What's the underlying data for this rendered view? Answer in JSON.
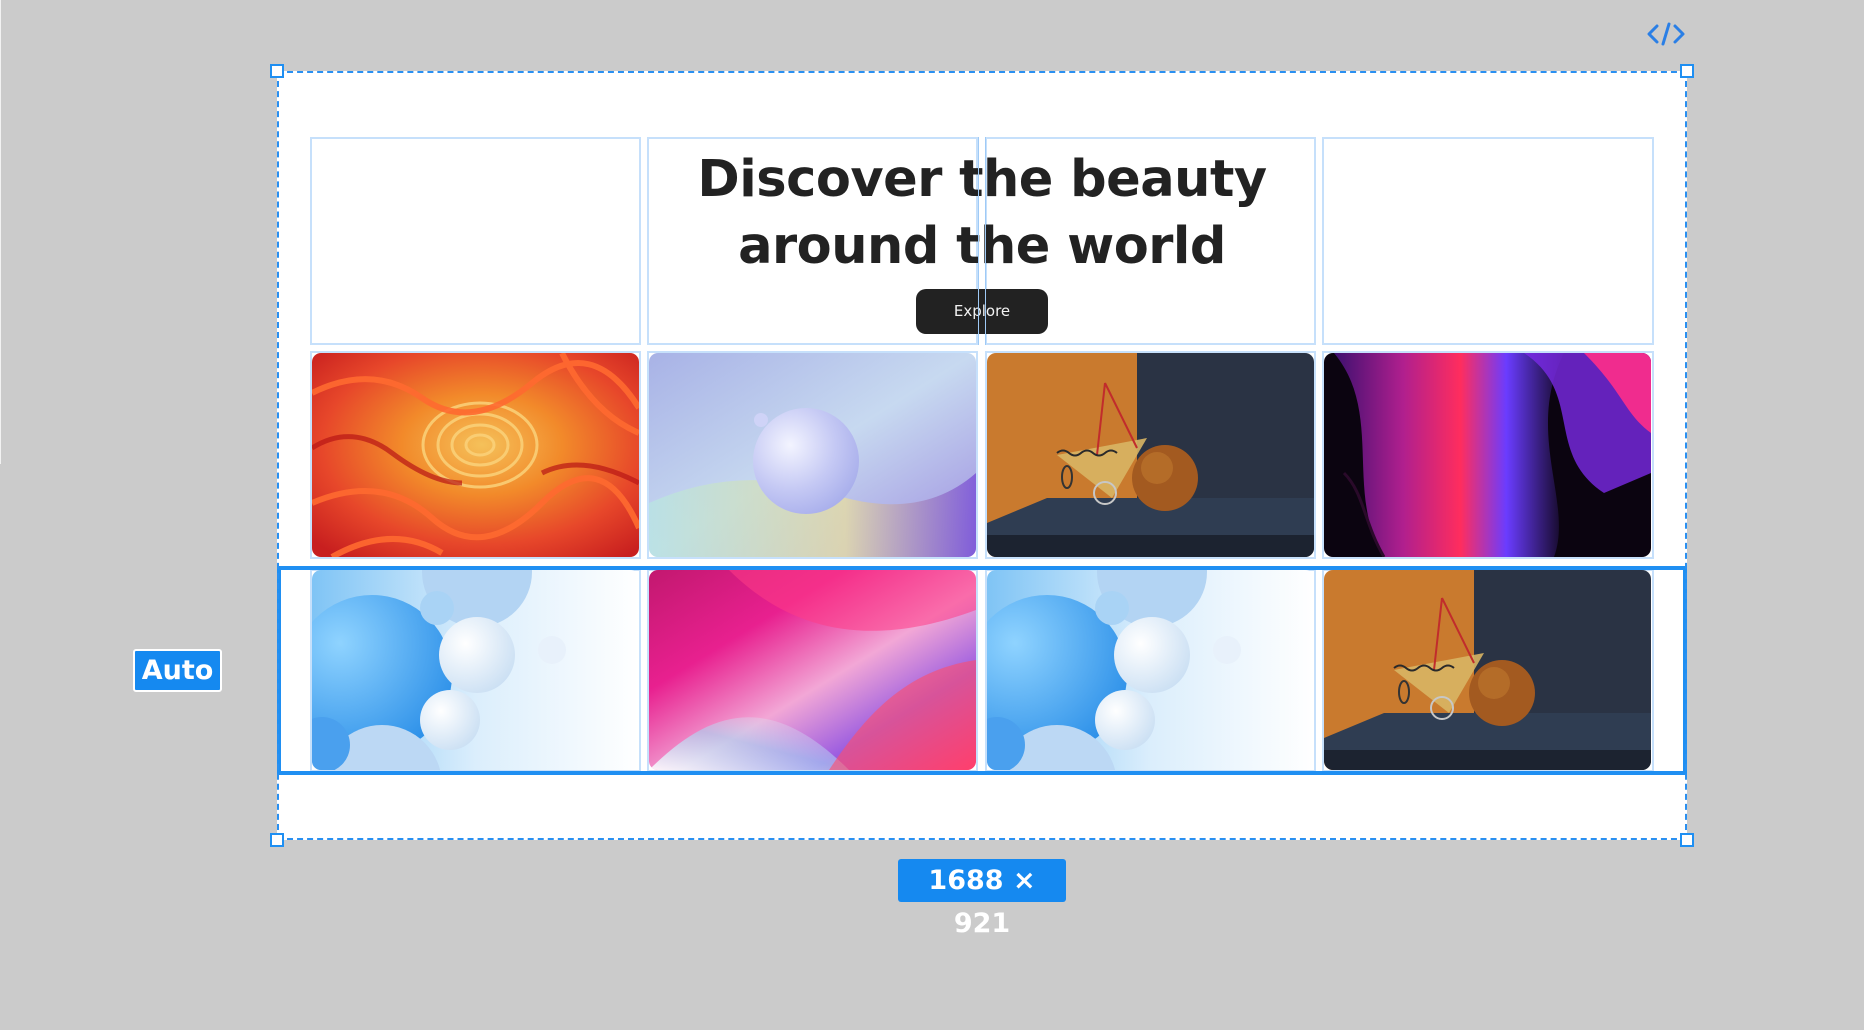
{
  "canvas": {
    "background": "#cbcbcb",
    "accent": "#1f8ff2"
  },
  "toolbar": {
    "code_icon": "code-icon"
  },
  "hero": {
    "title_line1": "Discover the beauty",
    "title_line2": "around the world",
    "button_label": "Explore"
  },
  "gallery": {
    "row1": [
      "orange-paper-swirl",
      "pastel-spheres",
      "orange-navy-3d-scene",
      "neon-liquid-shapes"
    ],
    "row2": [
      "blue-bubbles",
      "pink-blue-gradient",
      "blue-bubbles",
      "orange-navy-3d-scene"
    ]
  },
  "selection": {
    "row_sizing_label": "Auto",
    "frame_size_label": "1688 × 921"
  }
}
